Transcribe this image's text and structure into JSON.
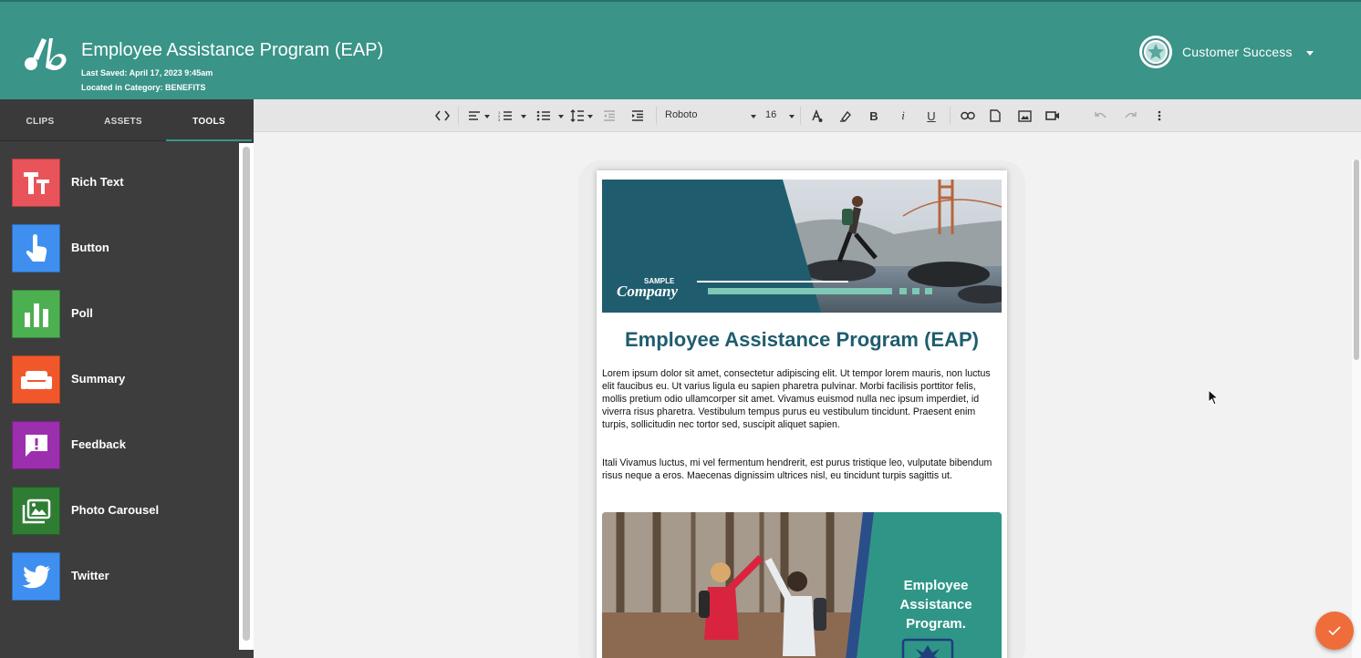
{
  "header": {
    "title": "Employee Assistance Program (EAP)",
    "last_saved": "Last Saved: April 17, 2023 9:45am",
    "category": "Located in Category: BENEFITS",
    "user_name": "Customer Success",
    "logo_icon": "brand-logo-icon",
    "avatar_icon": "star-badge-icon"
  },
  "sidebar": {
    "tabs": [
      {
        "label": "CLIPS"
      },
      {
        "label": "ASSETS"
      },
      {
        "label": "TOOLS"
      }
    ],
    "active_tab": "TOOLS",
    "tools": [
      {
        "label": "Rich Text",
        "icon": "rich-text-icon",
        "color": "#e8545a"
      },
      {
        "label": "Button",
        "icon": "touch-icon",
        "color": "#3f8ff0"
      },
      {
        "label": "Poll",
        "icon": "bar-chart-icon",
        "color": "#4caf50"
      },
      {
        "label": "Summary",
        "icon": "couch-icon",
        "color": "#f0582b"
      },
      {
        "label": "Feedback",
        "icon": "feedback-icon",
        "color": "#9c2fae"
      },
      {
        "label": "Photo Carousel",
        "icon": "photos-icon",
        "color": "#2e7d32"
      },
      {
        "label": "Twitter",
        "icon": "twitter-icon",
        "color": "#3f8ff0"
      }
    ]
  },
  "toolbar": {
    "font": "Roboto",
    "size": "16"
  },
  "email": {
    "banner_brand_small": "SAMPLE",
    "banner_brand": "Company",
    "title": "Employee Assistance Program (EAP)",
    "paragraph1": "Lorem ipsum dolor sit amet, consectetur adipiscing elit. Ut tempor lorem mauris, non luctus elit faucibus eu. Ut varius ligula eu sapien pharetra pulvinar. Morbi facilisis porttitor felis, mollis pretium odio ullamcorper sit amet. Vivamus euismod nulla nec ipsum imperdiet, id viverra risus pharetra. Vestibulum tempus purus eu vestibulum tincidunt. Praesent enim turpis, sollicitudin nec tortor sed, suscipit aliquet sapien.",
    "paragraph2": "Itali Vivamus luctus, mi vel fermentum hendrerit, est purus tristique leo, vulputate bibendum risus neque a eros. Maecenas dignissim ultrices nisl, eu tincidunt turpis sagittis ut.",
    "image_caption_line1": "Employee",
    "image_caption_line2": "Assistance",
    "image_caption_line3": "Program."
  },
  "colors": {
    "header": "#3a9488",
    "sidebar": "#3d3d3d",
    "accent": "#3a9488",
    "title_text": "#1f5d6e",
    "fab": "#ee6d3a"
  }
}
